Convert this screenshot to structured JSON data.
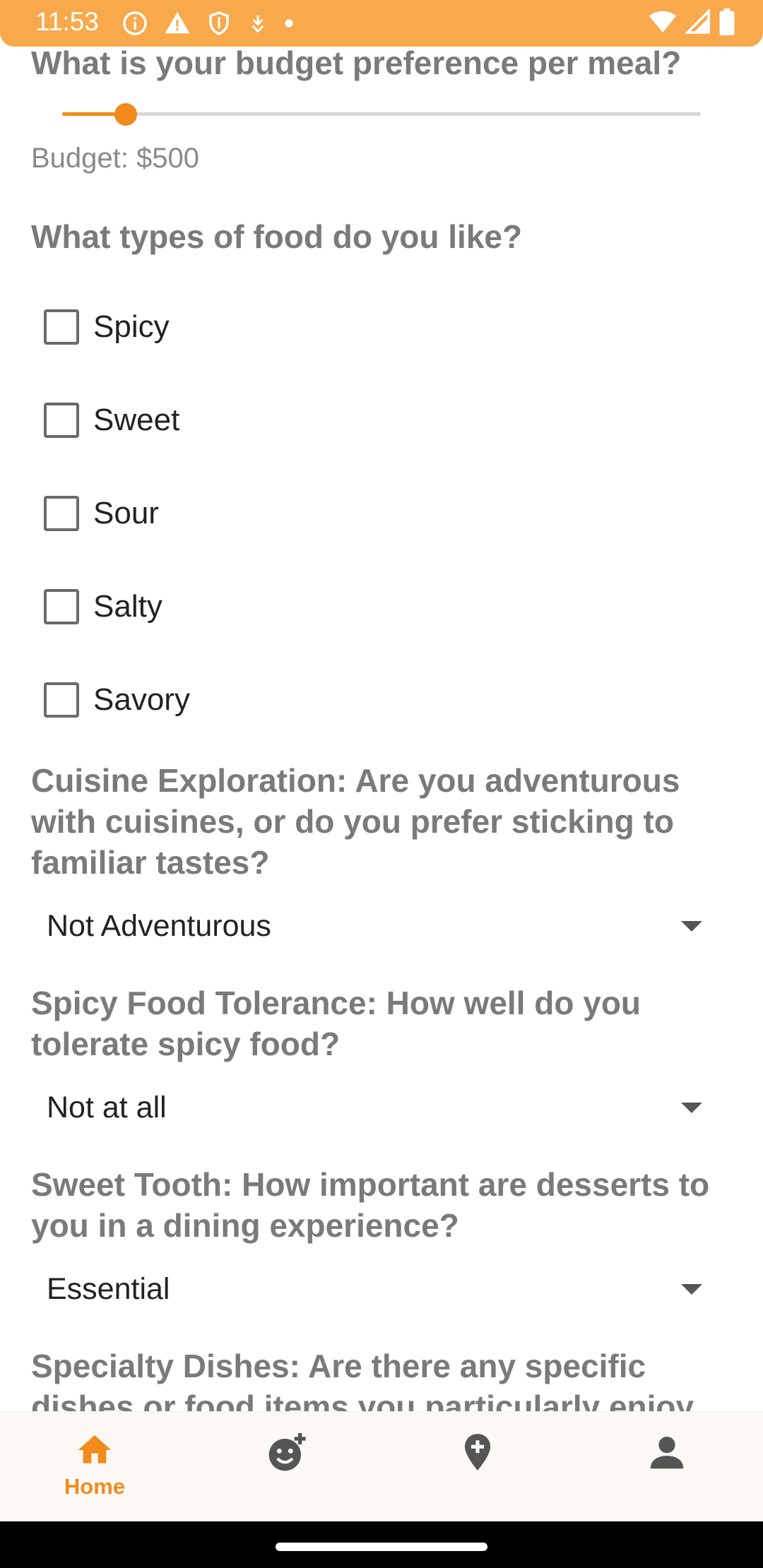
{
  "status_bar": {
    "time": "11:53",
    "left_icons": [
      "info-icon",
      "warning-icon",
      "shield-icon",
      "download-icon",
      "dot-icon"
    ],
    "right_icons": [
      "wifi-icon",
      "signal-icon",
      "battery-icon"
    ],
    "color": "#f7a94b"
  },
  "survey": {
    "budget_question": "What is your budget preference per meal?",
    "budget_slider_fraction": 0.1,
    "budget_text": "Budget: $500",
    "food_question": "What types of food do you like?",
    "food_options": [
      {
        "label": "Spicy",
        "checked": false
      },
      {
        "label": "Sweet",
        "checked": false
      },
      {
        "label": "Sour",
        "checked": false
      },
      {
        "label": "Salty",
        "checked": false
      },
      {
        "label": "Savory",
        "checked": false
      }
    ],
    "cuisine_question": "Cuisine Exploration: Are you adventurous with cuisines, or do you prefer sticking to familiar tastes?",
    "cuisine_value": "Not Adventurous",
    "spicy_question": "Spicy Food Tolerance: How well do you tolerate spicy food?",
    "spicy_value": "Not at all",
    "sweet_question": "Sweet Tooth: How important are desserts to you in a dining experience?",
    "sweet_value": "Essential",
    "specialty_question": "Specialty Dishes: Are there any specific dishes or food items you particularly enjoy"
  },
  "bottom_nav": {
    "items": [
      {
        "label": "Home",
        "icon": "home-icon",
        "active": true
      },
      {
        "label": "",
        "icon": "add-reaction-icon",
        "active": false
      },
      {
        "label": "",
        "icon": "add-location-icon",
        "active": false
      },
      {
        "label": "",
        "icon": "person-icon",
        "active": false
      }
    ],
    "accent": "#f28a1c",
    "inactive": "#555555"
  }
}
